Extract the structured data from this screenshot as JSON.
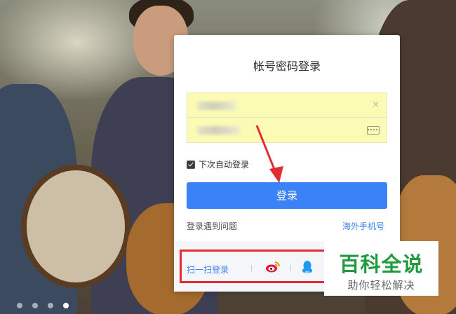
{
  "login_card": {
    "title": "帐号密码登录",
    "username_field": {
      "value": ""
    },
    "password_field": {
      "value": ""
    },
    "remember_me": {
      "label": "下次自动登录",
      "checked": true
    },
    "login_button": "登录",
    "help_link": "登录遇到问题",
    "overseas_link": "海外手机号",
    "alt_login": {
      "qr_label": "扫一扫登录",
      "icons": [
        "weibo-icon",
        "qq-icon"
      ]
    }
  },
  "carousel": {
    "dots": 4,
    "active_index": 3
  },
  "watermark": {
    "main": "百科全说",
    "sub": "助你轻松解决"
  },
  "colors": {
    "accent": "#3b82f6",
    "autofill": "#fbfbb4",
    "highlight_box": "#e42a32",
    "watermark_green": "#1f9a3d"
  }
}
